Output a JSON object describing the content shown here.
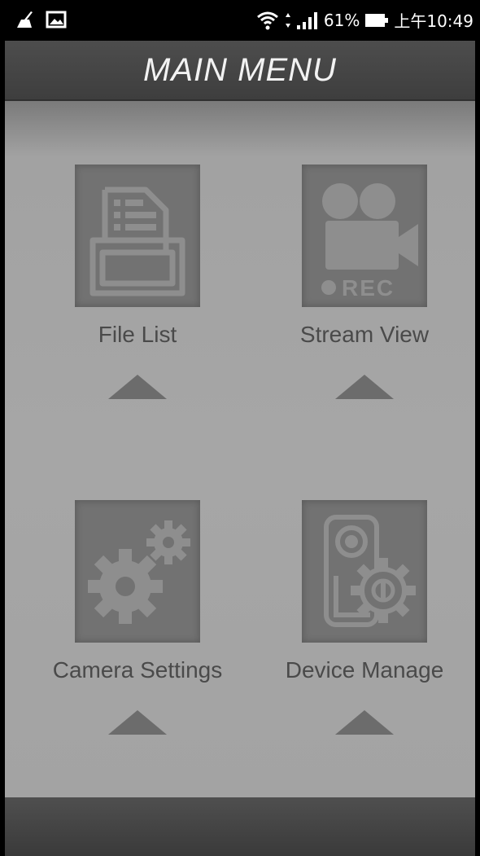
{
  "status_bar": {
    "battery_percent": "61%",
    "time": "上午10:49",
    "icons": [
      "broom-icon",
      "image-icon",
      "wifi-icon",
      "signal-icon",
      "battery-icon"
    ]
  },
  "header": {
    "title": "MAIN MENU"
  },
  "menu": {
    "items": [
      {
        "label": "File List",
        "icon": "file-folder-icon"
      },
      {
        "label": "Stream View",
        "icon": "rec-camera-icon"
      },
      {
        "label": "Camera Settings",
        "icon": "gears-icon"
      },
      {
        "label": "Device Manage",
        "icon": "device-gear-icon"
      }
    ],
    "rec_text": "●REC"
  },
  "colors": {
    "header_bg": "#454545",
    "panel_bg": "#a6a6a6",
    "icon_box_bg": "#727272",
    "icon_fg": "#8e8e8e",
    "label_color": "#4a4a4a"
  }
}
